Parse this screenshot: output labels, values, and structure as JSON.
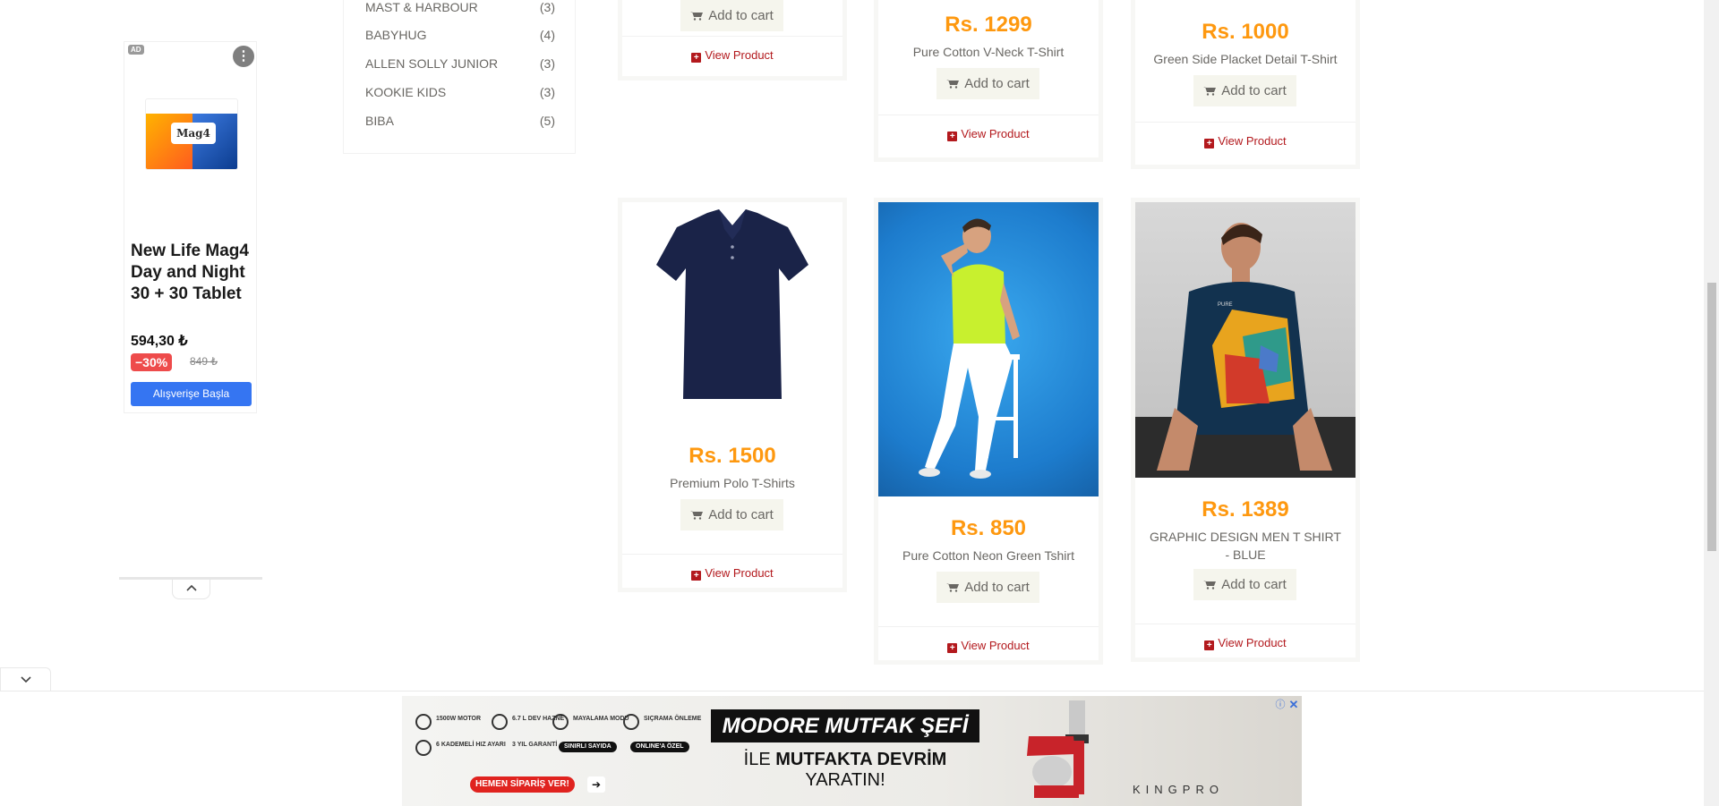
{
  "side_ad": {
    "ad_tag": "AD",
    "menu_icon": "⋮",
    "image_label": "Mag4",
    "title": "New Life Mag4 Day and Night 30 + 30 Tablet",
    "price": "594,30 ₺",
    "discount": "−30%",
    "old_price": "849 ₺",
    "cta": "Alışverişe Başla",
    "collapse_icon": "chevron-up-icon"
  },
  "brands": [
    {
      "name": "MAST & HARBOUR",
      "count": "(3)"
    },
    {
      "name": "BABYHUG",
      "count": "(4)"
    },
    {
      "name": "ALLEN SOLLY JUNIOR",
      "count": "(3)"
    },
    {
      "name": "KOOKIE KIDS",
      "count": "(3)"
    },
    {
      "name": "BIBA",
      "count": "(5)"
    }
  ],
  "products": [
    {
      "price": "",
      "name": "",
      "cart": "Add to cart",
      "view": "View Product"
    },
    {
      "price": "Rs. 1299",
      "name": "Pure Cotton V-Neck T-Shirt",
      "cart": "Add to cart",
      "view": "View Product"
    },
    {
      "price": "Rs. 1000",
      "name": "Green Side Placket Detail T-Shirt",
      "cart": "Add to cart",
      "view": "View Product"
    },
    {
      "price": "Rs. 1500",
      "name": "Premium Polo T-Shirts",
      "cart": "Add to cart",
      "view": "View Product"
    },
    {
      "price": "Rs. 850",
      "name": "Pure Cotton Neon Green Tshirt",
      "cart": "Add to cart",
      "view": "View Product"
    },
    {
      "price": "Rs. 1389",
      "name": "GRAPHIC DESIGN MEN T SHIRT - BLUE",
      "cart": "Add to cart",
      "view": "View Product"
    }
  ],
  "bottom_ad": {
    "features": [
      "1500W MOTOR",
      "6.7 L DEV HAZNE",
      "MAYALAMA MODU",
      "SIÇRAMA ÖNLEME",
      "6 KADEMELİ HIZ AYARI",
      "3 YIL GARANTİ",
      "SINIRLI SAYIDA",
      "ONLINE'A ÖZEL"
    ],
    "headline": "MODORE MUTFAK ŞEFİ",
    "sub_pre": "İLE ",
    "sub_bold": "MUTFAKTA DEVRİM",
    "sub_post": " YARATIN!",
    "cta": "HEMEN SİPARİŞ VER!",
    "brand": "KINGPRO",
    "info_icon": "ⓘ",
    "close_icon": "✕"
  },
  "colors": {
    "price": "#fe980f",
    "view_link": "#b3191d",
    "ad_cta": "#3575f2",
    "ad_discount": "#ee4b4b"
  }
}
